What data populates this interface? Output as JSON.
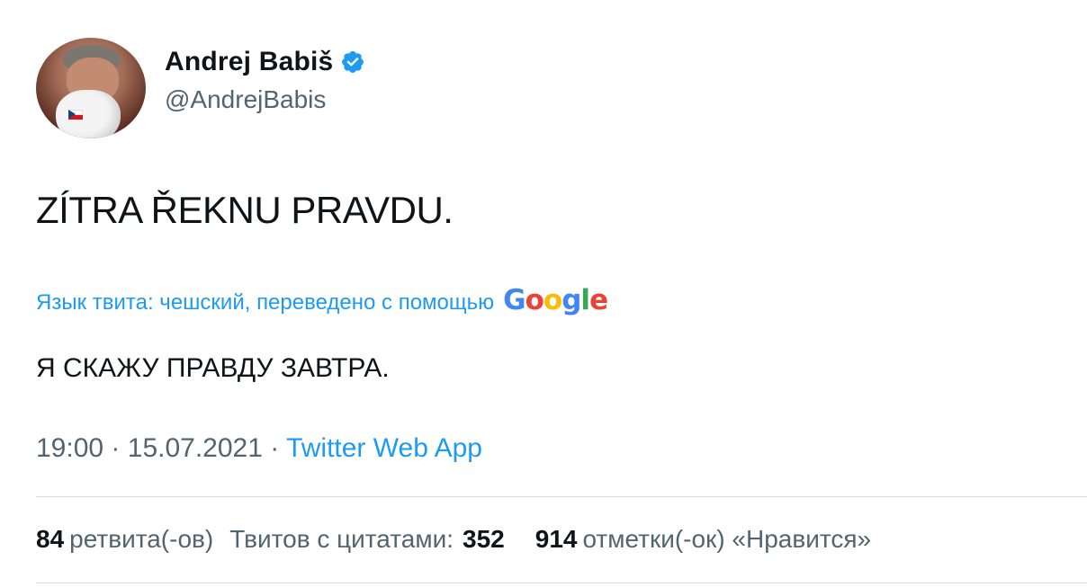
{
  "author": {
    "display_name": "Andrej Babiš",
    "handle": "@AndrejBabis",
    "verified": true,
    "avatar_icon": "avatar-photo-with-face-mask",
    "verified_color": "#1d9bf0"
  },
  "tweet": {
    "text": "ZÍTRA ŘEKNU PRAVDU.",
    "translation_label": "Язык твита: чешский, переведено с помощью",
    "translation_provider_logo": "Google",
    "translated_text": "Я СКАЖУ ПРАВДУ ЗАВТРА.",
    "time": "19:00",
    "separator": "·",
    "date": "15.07.2021",
    "source": "Twitter Web App"
  },
  "stats": {
    "retweets_count": "84",
    "retweets_label": "ретвита(-ов)",
    "quotes_label": "Твитов с цитатами:",
    "quotes_count": "352",
    "likes_count": "914",
    "likes_label": "отметки(-ок) «Нравится»"
  },
  "colors": {
    "link": "#1d9bf0",
    "text": "#0f1419",
    "secondary": "#536471",
    "divider": "#d6dbdf"
  }
}
